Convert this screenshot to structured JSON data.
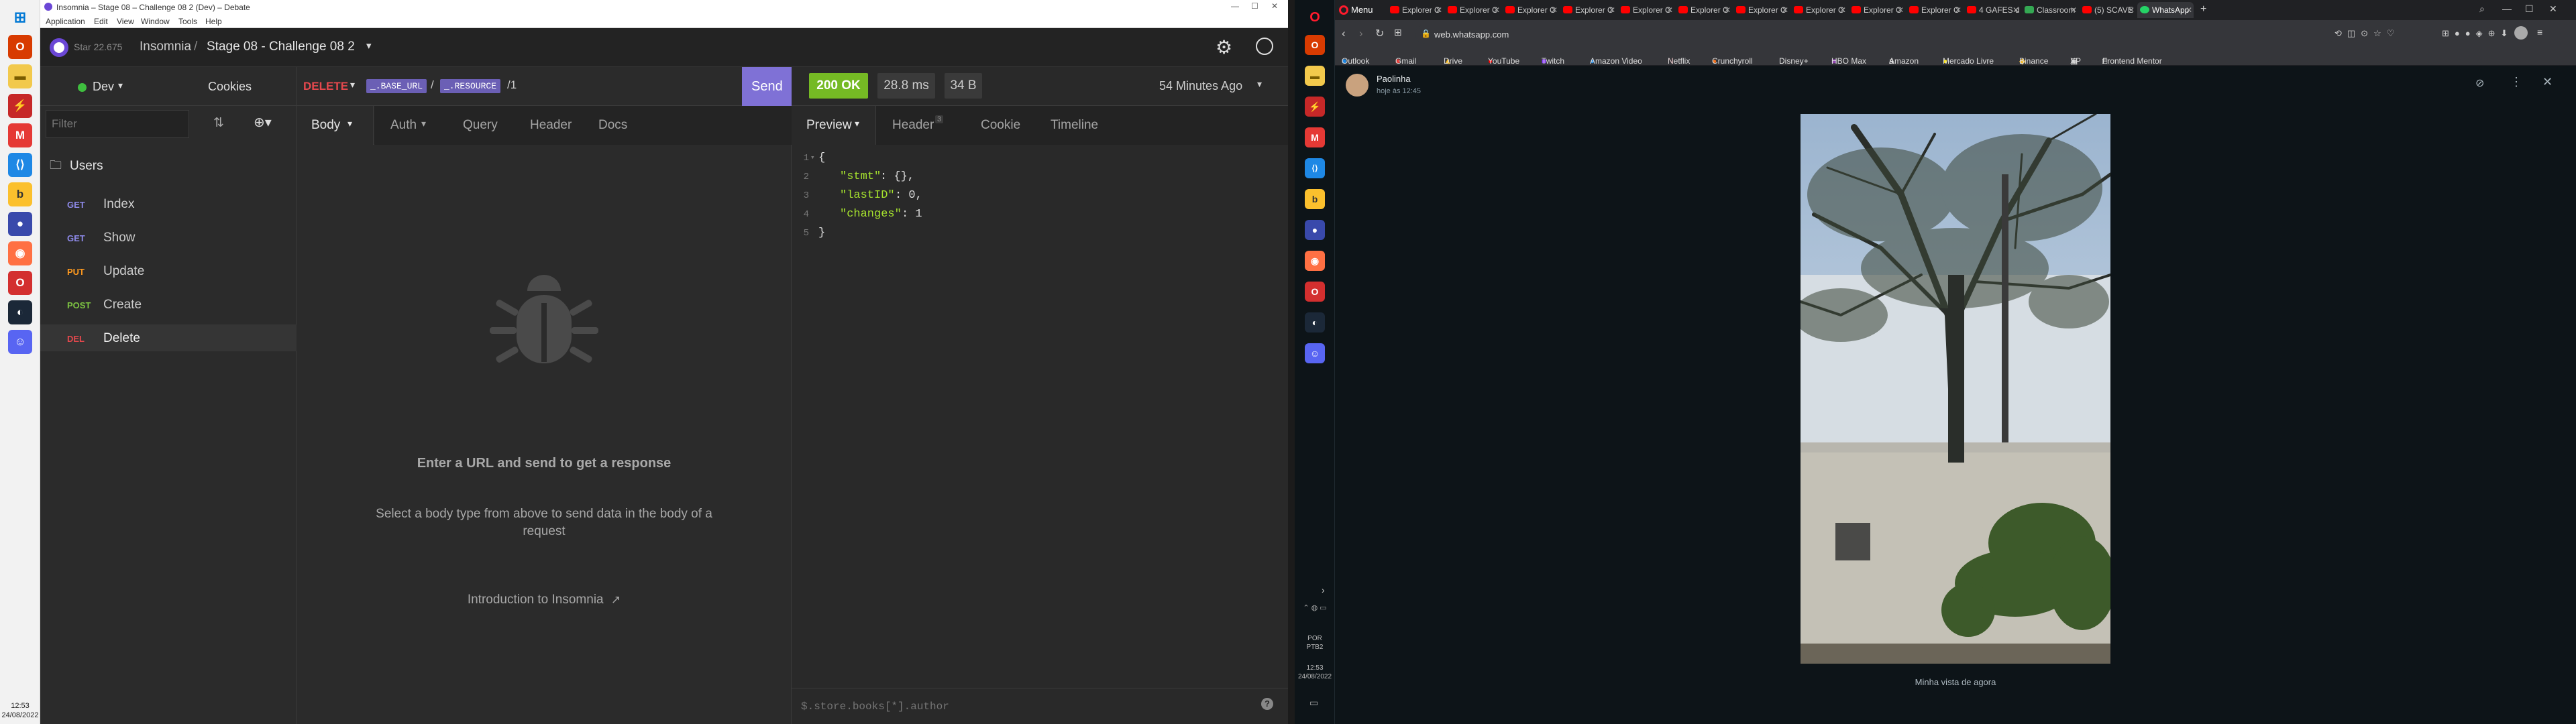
{
  "taskbar_left": {
    "apps": [
      "windows-start",
      "office-icon",
      "file-explorer-icon",
      "pdf-icon",
      "gmail-icon",
      "vscode-icon",
      "keep-icon",
      "chrome-icon",
      "firefox-icon",
      "opera-icon",
      "steam-icon",
      "discord-icon"
    ],
    "time": "12:53",
    "date": "24/08/2022"
  },
  "insomnia": {
    "window_title": "Insomnia – Stage 08 – Challenge 08 2 (Dev) – Debate",
    "menu": [
      "Application",
      "Edit",
      "View",
      "Window",
      "Tools",
      "Help"
    ],
    "star_count": "Star 22.675",
    "app_name": "Insomnia",
    "breadcrumb_sep": "/",
    "workspace": "Stage 08 - Challenge 08 2",
    "environment": "Dev",
    "cookies": "Cookies",
    "filter_placeholder": "Filter",
    "folder": "Users",
    "requests": [
      {
        "method": "GET",
        "name": "Index",
        "color": "#8d89e8"
      },
      {
        "method": "GET",
        "name": "Show",
        "color": "#8d89e8"
      },
      {
        "method": "PUT",
        "name": "Update",
        "color": "#ff9a1f"
      },
      {
        "method": "POST",
        "name": "Create",
        "color": "#7dc442"
      },
      {
        "method": "DEL",
        "name": "Delete",
        "color": "#e5484d"
      }
    ],
    "url": {
      "method": "DELETE",
      "base": "_.BASE_URL",
      "sep": "/",
      "resource": "_.RESOURCE",
      "tail": "/1"
    },
    "send": "Send",
    "request_tabs": [
      "Body",
      "Auth",
      "Query",
      "Header",
      "Docs"
    ],
    "empty_title": "Enter a URL and send to get a response",
    "empty_text": "Select a body type from above to send data in the body of a request",
    "intro_link": "Introduction to Insomnia",
    "status": "200 OK",
    "time": "28.8 ms",
    "size": "34 B",
    "ago": "54 Minutes Ago",
    "response_tabs": [
      "Preview",
      "Header",
      "Cookie",
      "Timeline"
    ],
    "header_count": "3",
    "response_lines": [
      {
        "n": "1",
        "k": "",
        "v": "{"
      },
      {
        "n": "2",
        "k": "\"stmt\"",
        "v": ": {},"
      },
      {
        "n": "3",
        "k": "\"lastID\"",
        "v": ": 0,"
      },
      {
        "n": "4",
        "k": "\"changes\"",
        "v": ": 1"
      },
      {
        "n": "5",
        "k": "",
        "v": "}"
      }
    ],
    "filter_query": "$.store.books[*].author",
    "help": "?",
    "colors": {
      "accent": "#7f71d6",
      "ok": "#75ba24",
      "delete": "#e5484d"
    }
  },
  "opera_sidebar": {
    "time": "12:53",
    "date": "24/08/2022",
    "lang": "POR",
    "lang2": "PTB2"
  },
  "browser": {
    "menu": "Menu",
    "tabs": [
      "Explorer C",
      "Explorer C",
      "Explorer C",
      "Explorer C",
      "Explorer C",
      "Explorer C",
      "Explorer C",
      "Explorer C",
      "Explorer C",
      "Explorer C",
      "4 GAFES d",
      "Classroom",
      "(5) SCAVE",
      "WhatsApp"
    ],
    "address": "web.whatsapp.com",
    "bookmarks": [
      "Outlook",
      "Gmail",
      "Drive",
      "YouTube",
      "Twitch",
      "Amazon Video",
      "Netflix",
      "Crunchyroll",
      "Disney+",
      "HBO Max",
      "Amazon",
      "Mercado Livre",
      "Binance",
      "XP",
      "Frontend Mentor"
    ],
    "whatsapp": {
      "name": "Paolinha",
      "time": "hoje às 12:45",
      "caption": "Minha vista de agora"
    }
  }
}
